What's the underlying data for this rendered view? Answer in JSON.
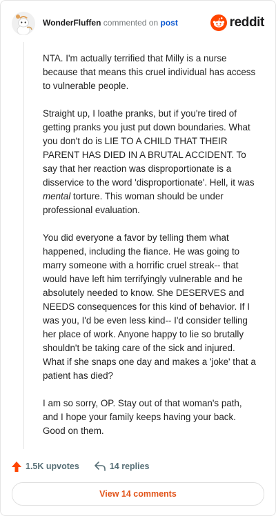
{
  "header": {
    "username": "WonderFluffen",
    "action": "commented on",
    "target": "post",
    "brand": "reddit"
  },
  "comment": {
    "paragraphs": [
      "NTA. I'm actually terrified that Milly is a nurse because that means this cruel individual has access to vulnerable people.",
      "Straight up, I loathe pranks, but if you're tired of getting pranks you just put down boundaries. What you don't do is LIE TO A CHILD THAT THEIR PARENT HAS DIED IN A BRUTAL ACCIDENT. To say that her reaction was disproportionate is a disservice to the word 'disproportionate'. Hell, it was mental torture. This woman should be under professional evaluation.",
      "You did everyone a favor by telling them what happened, including the fiance. He was going to marry someone with a horrific cruel streak-- that would have left him terrifyingly vulnerable and he absolutely needed to know. She DESERVES and NEEDS consequences for this kind of behavior. If I was you, I'd be even less kind-- I'd consider telling her place of work. Anyone happy to lie so brutally shouldn't be taking care of the sick and injured. What if she snaps one day and makes a 'joke' that a patient has died?",
      "I am so sorry, OP. Stay out of that woman's path, and I hope your family keeps having your back. Good on them."
    ]
  },
  "footer": {
    "upvotes": "1.5K upvotes",
    "replies": "14 replies",
    "view_button": "View 14 comments"
  },
  "colors": {
    "brand_orange": "#ff4500",
    "link_blue": "#0b57d0",
    "button_text": "#e2541a"
  },
  "icons": {
    "avatar": "avatar-icon",
    "brand": "reddit-logo-icon",
    "upvote": "upvote-arrow-icon",
    "reply": "reply-arrow-icon"
  }
}
